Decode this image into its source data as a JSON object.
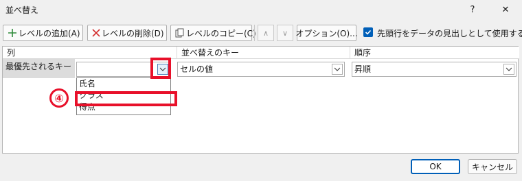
{
  "window": {
    "title": "並べ替え",
    "help": "?",
    "close": "✕"
  },
  "toolbar": {
    "add_level": "レベルの追加(A)",
    "delete_level": "レベルの削除(D)",
    "copy_level": "レベルのコピー(C)",
    "move_up": "∧",
    "move_down": "∨",
    "options": "オプション(O)...",
    "has_headers_checked": true,
    "has_headers_label": "先頭行をデータの見出しとして使用する(H)"
  },
  "grid": {
    "headers": {
      "column": "列",
      "sort_on": "並べ替えのキー",
      "order": "順序"
    },
    "rows": [
      {
        "label": "最優先されるキー",
        "column_value": "",
        "sort_on_value": "セルの値",
        "order_value": "昇順"
      }
    ],
    "column_dropdown_options": [
      "氏名",
      "クラス",
      "得点"
    ]
  },
  "annotation": {
    "step_number": "④",
    "color": "#e8102a"
  },
  "footer": {
    "ok": "OK",
    "cancel": "キャンセル"
  },
  "colors": {
    "accent": "#005fb8",
    "highlight": "#e8102a"
  }
}
